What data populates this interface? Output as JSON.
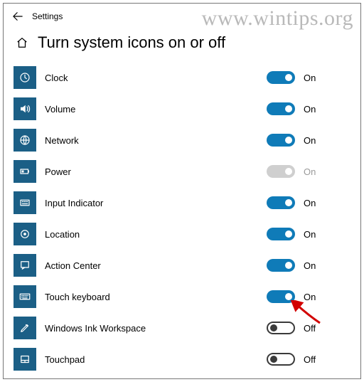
{
  "watermark": "www.wintips.org",
  "app_title": "Settings",
  "page_title": "Turn system icons on or off",
  "state_labels": {
    "on": "On",
    "off": "Off"
  },
  "colors": {
    "accent": "#0f7bb8",
    "tile": "#1b5f86"
  },
  "items": [
    {
      "id": "clock",
      "label": "Clock",
      "state": "on",
      "icon": "clock-icon"
    },
    {
      "id": "volume",
      "label": "Volume",
      "state": "on",
      "icon": "volume-icon"
    },
    {
      "id": "network",
      "label": "Network",
      "state": "on",
      "icon": "globe-icon"
    },
    {
      "id": "power",
      "label": "Power",
      "state": "disabled",
      "icon": "battery-icon"
    },
    {
      "id": "input-indicator",
      "label": "Input Indicator",
      "state": "on",
      "icon": "input-indicator-icon"
    },
    {
      "id": "location",
      "label": "Location",
      "state": "on",
      "icon": "location-icon"
    },
    {
      "id": "action-center",
      "label": "Action Center",
      "state": "on",
      "icon": "action-center-icon"
    },
    {
      "id": "touch-keyboard",
      "label": "Touch keyboard",
      "state": "on",
      "icon": "keyboard-icon",
      "highlight_arrow": true
    },
    {
      "id": "ink-workspace",
      "label": "Windows Ink Workspace",
      "state": "off",
      "icon": "pen-icon"
    },
    {
      "id": "touchpad",
      "label": "Touchpad",
      "state": "off",
      "icon": "touchpad-icon"
    }
  ]
}
